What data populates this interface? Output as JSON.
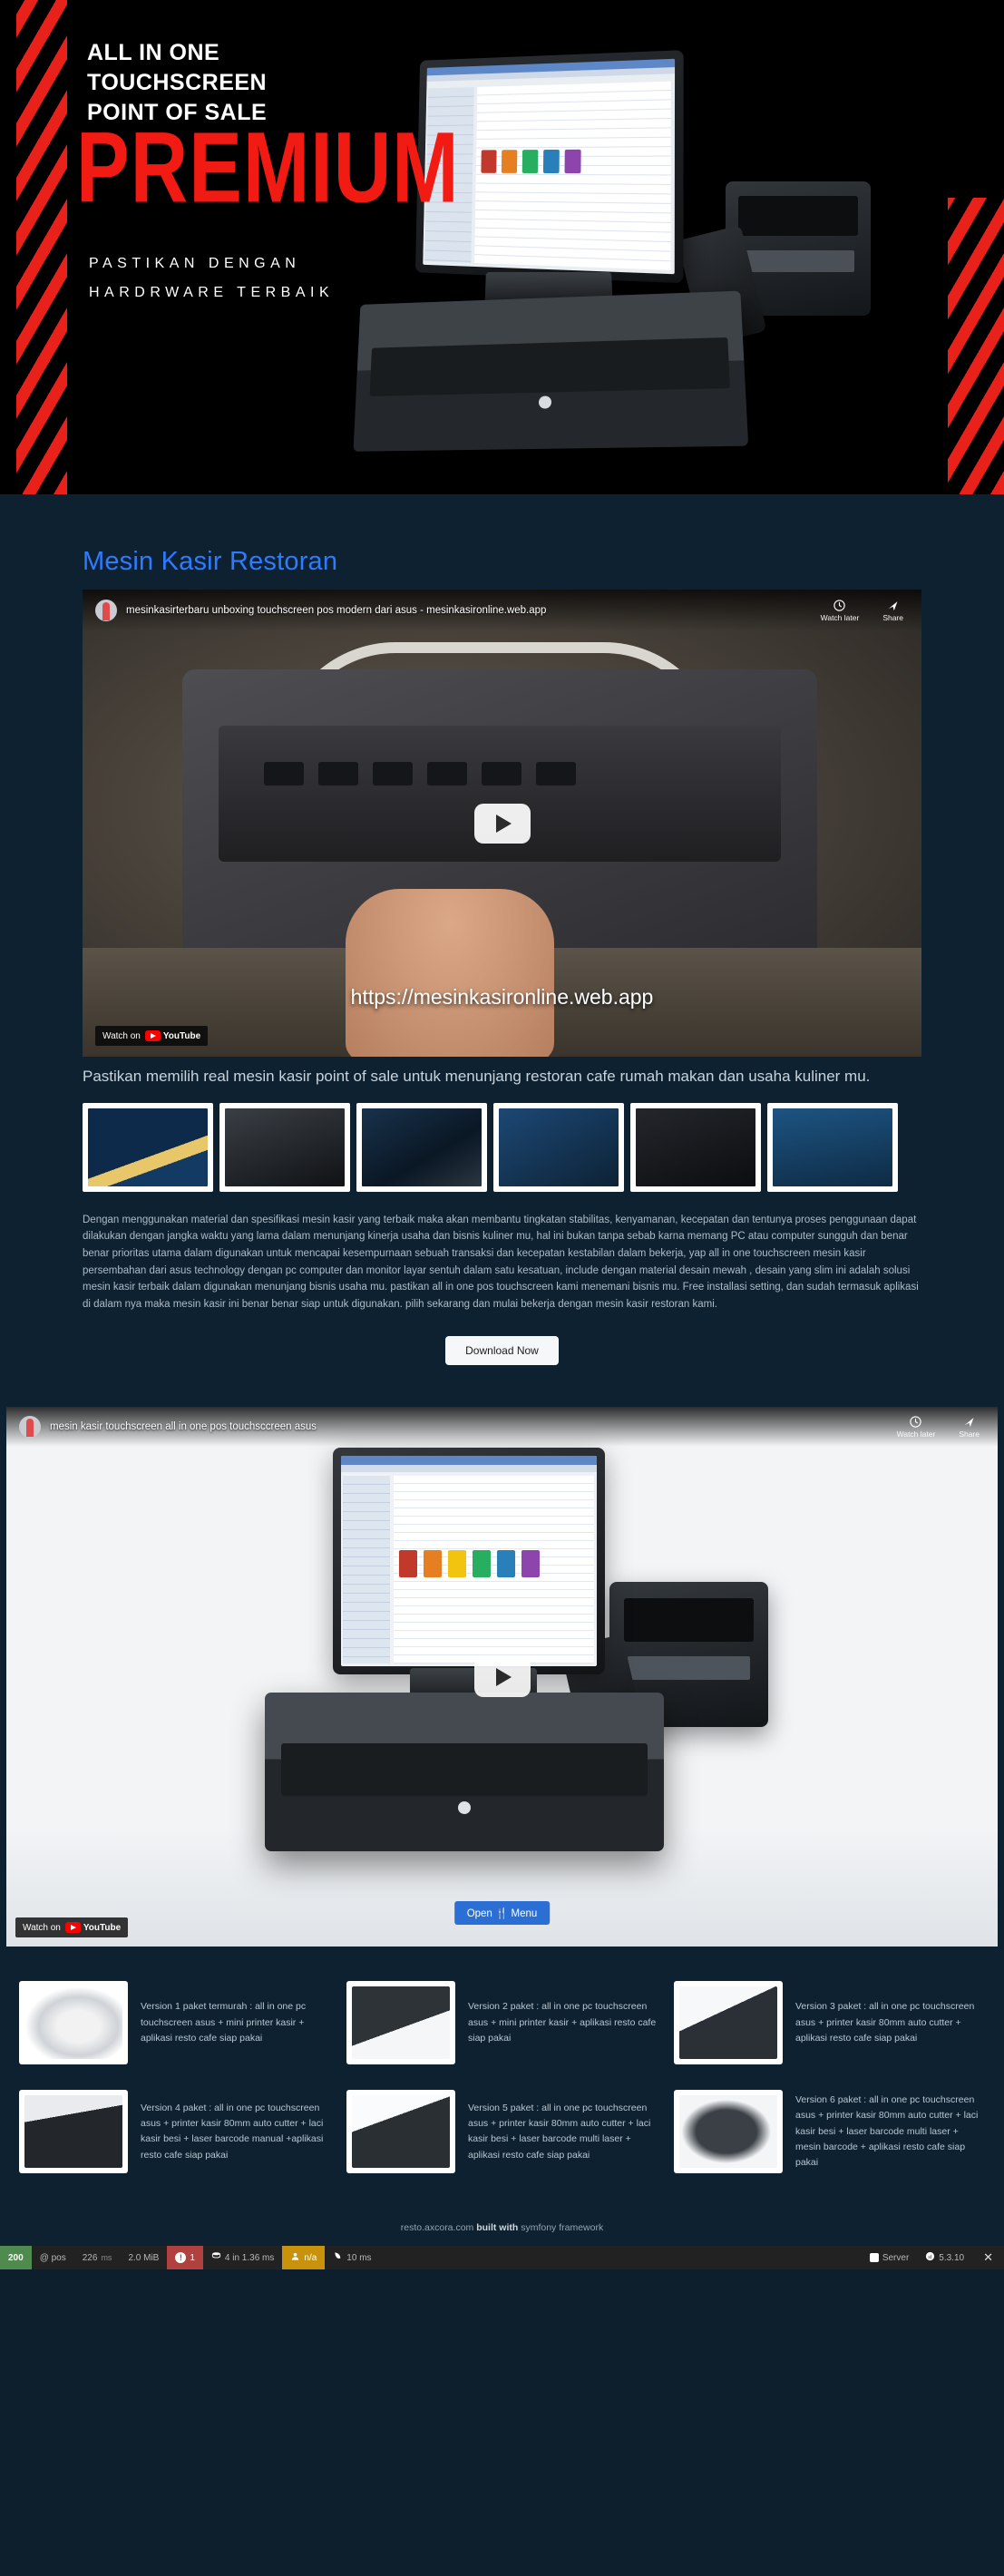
{
  "hero": {
    "headline": "ALL IN ONE\nTOUCHSCREEN\nPOINT OF SALE",
    "headline_line1": "ALL IN ONE",
    "headline_line2": "TOUCHSCREEN",
    "headline_line3": "POINT OF SALE",
    "premium": "PREMIUM",
    "sub_line1": "PASTIKAN DENGAN",
    "sub_line2": "HARDRWARE TERBAIK",
    "accent_color": "#f21b13",
    "background_color": "#000000"
  },
  "section": {
    "title": "Mesin Kasir Restoran",
    "title_color": "#2e7bff",
    "background_color": "#0d2130"
  },
  "video1": {
    "title": "mesinkasirterbaru unboxing touchscreen pos modern dari asus - mesinkasironline.web.app",
    "watch_later": "Watch later",
    "share": "Share",
    "watch_on": "Watch on",
    "youtube": "YouTube",
    "overlay_url": "https://mesinkasironline.web.app"
  },
  "lead": "Pastikan memilih real mesin kasir point of sale untuk menunjang restoran cafe rumah makan dan usaha kuliner mu.",
  "thumbnails": [
    {
      "name": "thumbnail-1"
    },
    {
      "name": "thumbnail-2"
    },
    {
      "name": "thumbnail-3"
    },
    {
      "name": "thumbnail-4"
    },
    {
      "name": "thumbnail-5"
    },
    {
      "name": "thumbnail-6"
    }
  ],
  "body_copy": "Dengan menggunakan material dan spesifikasi mesin kasir yang terbaik maka akan membantu tingkatan stabilitas, kenyamanan, kecepatan dan tentunya proses penggunaan dapat dilakukan dengan jangka waktu yang lama dalam menunjang kinerja usaha dan bisnis kuliner mu, hal ini bukan tanpa sebab karna memang PC atau computer sungguh dan benar benar prioritas utama dalam digunakan untuk mencapai kesempurnaan sebuah transaksi dan kecepatan kestabilan dalam bekerja, yap all in one touchscreen mesin kasir persembahan dari asus technology dengan pc computer dan monitor layar sentuh dalam satu kesatuan, include dengan material desain mewah , desain yang slim ini adalah solusi mesin kasir terbaik dalam digunakan menunjang bisnis usaha mu. pastikan all in one pos touchscreen kami menemani bisnis mu. Free installasi setting, dan sudah termasuk aplikasi di dalam nya maka mesin kasir ini benar benar siap untuk digunakan. pilih sekarang dan mulai bekerja dengan mesin kasir restoran kami.",
  "download_button": "Download Now",
  "video2": {
    "title": "mesin kasir touchscreen all in one pos touchsccreen asus",
    "watch_later": "Watch later",
    "share": "Share",
    "watch_on": "Watch on",
    "youtube": "YouTube",
    "cta": "Open 🍴 Menu"
  },
  "products": [
    {
      "desc": "Version 1 paket termurah : all in one pc touchscreen asus + mini printer kasir + aplikasi resto cafe siap pakai"
    },
    {
      "desc": "Version 2 paket : all in one pc touchscreen asus + mini printer kasir + aplikasi resto cafe siap pakai"
    },
    {
      "desc": "Version 3 paket : all in one pc touchscreen asus + printer kasir 80mm auto cutter + aplikasi resto cafe siap pakai"
    },
    {
      "desc": "Version 4 paket : all in one pc touchscreen asus + printer kasir 80mm auto cutter + laci kasir besi + laser barcode manual +aplikasi resto cafe siap pakai"
    },
    {
      "desc": "Version 5 paket : all in one pc touchscreen asus + printer kasir 80mm auto cutter + laci kasir besi + laser barcode multi laser + aplikasi resto cafe siap pakai"
    },
    {
      "desc": "Version 6 paket : all in one pc touchscreen asus + printer kasir 80mm auto cutter + laci kasir besi + laser barcode multi laser + mesin barcode + aplikasi resto cafe siap pakai"
    }
  ],
  "footer": {
    "site": "resto.axcora.com",
    "built_with": "built with",
    "framework": "symfony framework"
  },
  "debugbar": {
    "status_code": "200",
    "route": "@ pos",
    "time": "226",
    "time_unit": "ms",
    "memory": "2.0 MiB",
    "exception_count": "1",
    "doctrine": "4 in 1.36 ms",
    "security": "n/a",
    "twig": "10 ms",
    "server_label": "Server",
    "symfony_version": "5.3.10",
    "close": "✕",
    "status_color": "#4f8a4f",
    "error_color": "#b0413e",
    "warn_color": "#c9920b"
  }
}
